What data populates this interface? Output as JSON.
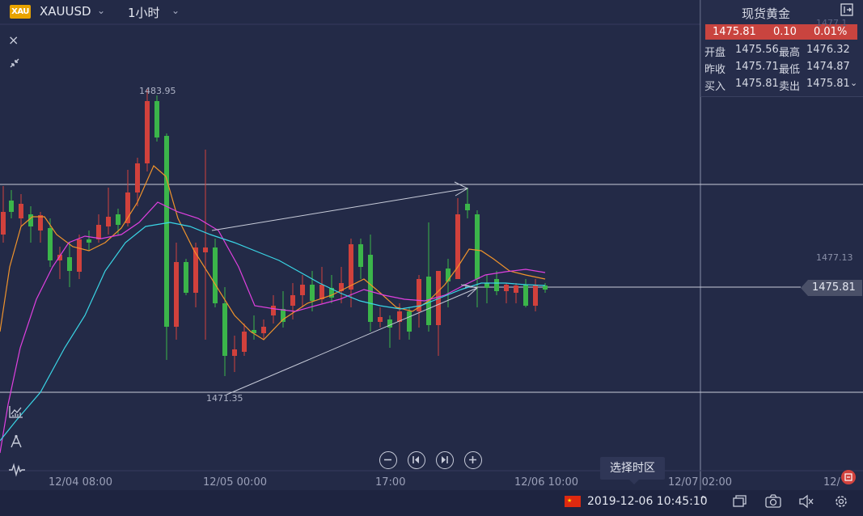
{
  "toolbar": {
    "logo_text": "XAU",
    "symbol": "XAUUSD",
    "period": "1小时"
  },
  "quote_panel": {
    "title": "现货黄金",
    "last": "1475.81",
    "change": "0.10",
    "change_pct": "0.01%",
    "rows": [
      {
        "k1": "开盘",
        "v1": "1475.56",
        "k2": "最高",
        "v2": "1476.32"
      },
      {
        "k1": "昨收",
        "v1": "1475.71",
        "k2": "最低",
        "v2": "1474.87"
      },
      {
        "k1": "买入",
        "v1": "1475.81",
        "k2": "卖出",
        "v2": "1475.81"
      }
    ],
    "colors": {
      "down": "#c9443f",
      "up": "#3bb54a"
    }
  },
  "price_axis": {
    "level_label": "1477.13",
    "current_price": "1475.81",
    "clipped_top": "1477.1"
  },
  "annotations": {
    "high": "1483.95",
    "low": "1471.35"
  },
  "time_axis": [
    "12/04 08:00",
    "12/05 00:00",
    "17:00",
    "12/06 10:00",
    "12/07 02:00",
    "12/"
  ],
  "bottom": {
    "datetime": "2019-12-06 10:45:10",
    "tooltip": "选择时区",
    "flag": "cn-flag-icon"
  },
  "chart_data": {
    "type": "candlestick",
    "symbol": "XAUUSD",
    "interval": "1h",
    "colors": {
      "up": "#3bb54a",
      "down": "#d1413c",
      "ma_fast": "#f0932b",
      "ma_mid": "#e040e0",
      "ma_slow": "#3ad6e6"
    },
    "annotated_high": 1483.95,
    "annotated_low": 1471.35,
    "horizontal_lines": [
      1478.9,
      1471.35,
      1475.81
    ]
  }
}
